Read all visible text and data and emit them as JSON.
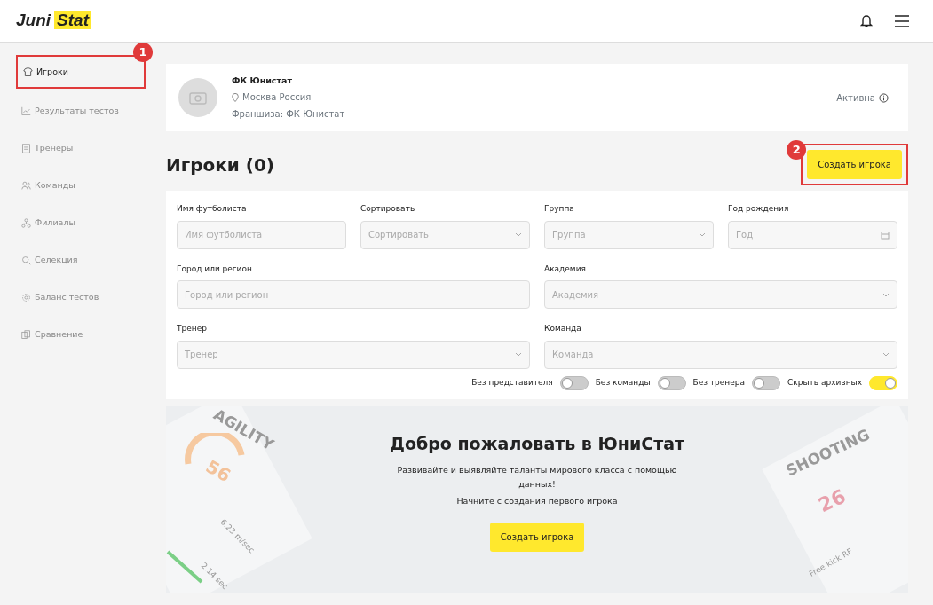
{
  "header": {
    "logo": [
      "Juni",
      "Stat"
    ]
  },
  "sidebar": {
    "items": [
      {
        "label": "Игроки",
        "selected": true,
        "callout": "1"
      },
      {
        "label": "Результаты тестов",
        "selected": false
      },
      {
        "label": "Тренеры",
        "selected": false
      },
      {
        "label": "Команды",
        "selected": false
      },
      {
        "label": "Филиалы",
        "selected": false
      },
      {
        "label": "Селекция",
        "selected": false
      },
      {
        "label": "Баланс тестов",
        "selected": false
      },
      {
        "label": "Сравнение",
        "selected": false
      }
    ]
  },
  "club": {
    "name": "ФК Юнистат",
    "location": "Москва Россия",
    "franchise": "Франшиза: ФК Юнистат",
    "status": "Активна"
  },
  "page_title": "Игроки (0)",
  "create_button": {
    "label": "Создать игрока",
    "callout": "2"
  },
  "filters": [
    {
      "label": "Имя футболиста",
      "placeholder": "Имя футболиста",
      "kind": "text"
    },
    {
      "label": "Сортировать",
      "placeholder": "Сортировать",
      "kind": "select"
    },
    {
      "label": "Группа",
      "placeholder": "Группа",
      "kind": "select"
    },
    {
      "label": "Год рождения",
      "placeholder": "Год",
      "kind": "date"
    },
    {
      "label": "Город или регион",
      "placeholder": "Город или регион",
      "kind": "text"
    },
    {
      "label": "Академия",
      "placeholder": "Академия",
      "kind": "select"
    },
    {
      "label": "Тренер",
      "placeholder": "Тренер",
      "kind": "select"
    },
    {
      "label": "Команда",
      "placeholder": "Команда",
      "kind": "select"
    }
  ],
  "toggles": [
    {
      "label": "Без представителя",
      "on": false
    },
    {
      "label": "Без команды",
      "on": false
    },
    {
      "label": "Без тренера",
      "on": false
    },
    {
      "label": "Скрыть архивных",
      "on": true
    }
  ],
  "welcome": {
    "title": "Добро пожаловать в ЮниСтат",
    "text": "Развивайте и выявляйте таланты мирового класса с помощью данных!",
    "hint": "Начните с создания первого игрока",
    "button": "Создать игрока"
  },
  "decor_left": {
    "title": "AGILITY",
    "score": "56",
    "reading_1": "6.23 m/sec",
    "reading_2": "2.14 sec"
  },
  "decor_right": {
    "title": "SHOOTING",
    "score": "26",
    "reading_1": "Free kick RF"
  }
}
